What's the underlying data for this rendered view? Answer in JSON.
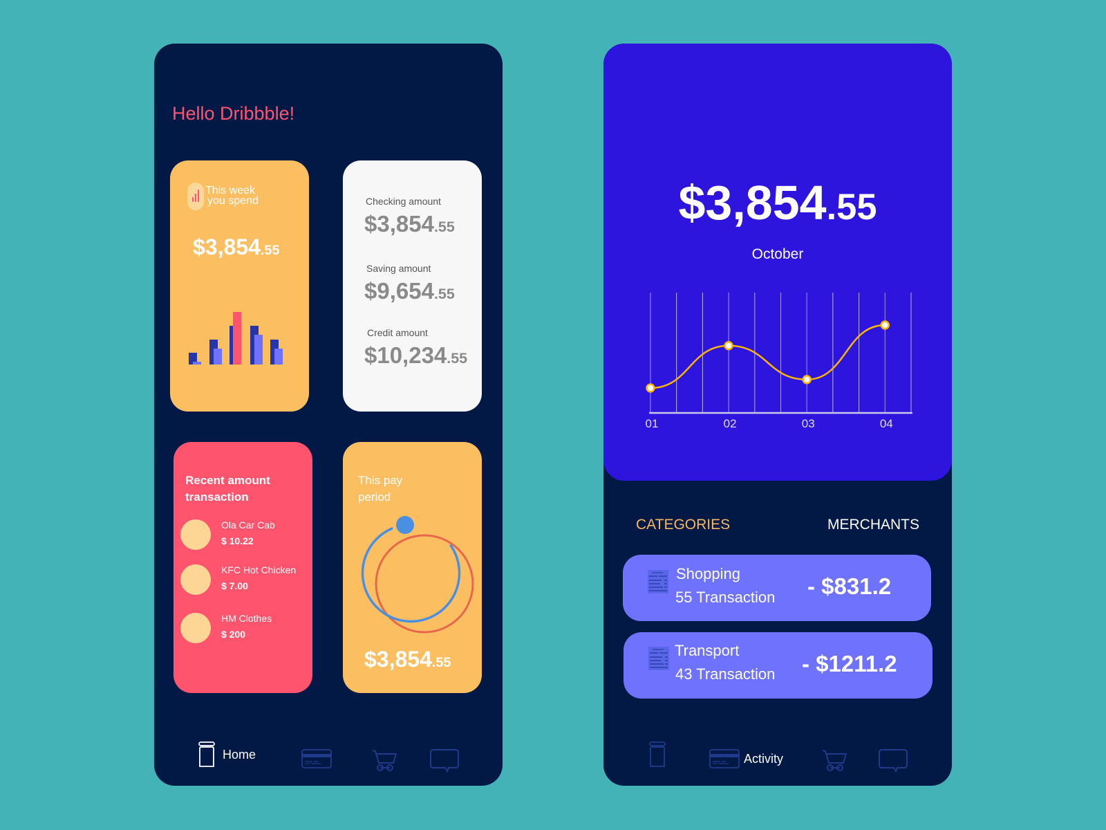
{
  "left_phone": {
    "greeting": "Hello Dribbble!",
    "spend_card": {
      "label_line1": "This week",
      "label_line2": "you spend",
      "amount_main": "$3,854",
      "amount_cents": ".55",
      "icon": "bar-chart-icon",
      "mini_chart": {
        "series": [
          {
            "name": "dark",
            "color": "#2636a8",
            "values": [
              0.22,
              0.48,
              0.74,
              0.74,
              0.48
            ]
          },
          {
            "name": "light",
            "color": "#6e72fc",
            "values": [
              0.05,
              0.3,
              1.0,
              0.56,
              0.3
            ]
          }
        ],
        "highlight_index": 2,
        "highlight_color": "#ff546d"
      }
    },
    "accounts_card": {
      "items": [
        {
          "label": "Checking amount",
          "amount_main": "$3,854",
          "amount_cents": ".55"
        },
        {
          "label": "Saving amount",
          "amount_main": "$9,654",
          "amount_cents": ".55"
        },
        {
          "label": "Credit amount",
          "amount_main": "$10,234",
          "amount_cents": ".55"
        }
      ]
    },
    "recent_card": {
      "title_line1": "Recent amount",
      "title_line2": "transaction",
      "transactions": [
        {
          "name": "Ola Car Cab",
          "amount": "$ 10.22"
        },
        {
          "name": "KFC Hot Chicken",
          "amount": "$ 7.00"
        },
        {
          "name": "HM Clothes",
          "amount": "$ 200"
        }
      ]
    },
    "pay_card": {
      "title_line1": "This pay",
      "title_line2": "period",
      "amount_main": "$3,854",
      "amount_cents": ".55",
      "ring_colors": {
        "progress": "#4a90e2",
        "track": "#e8674a"
      }
    },
    "nav": {
      "active": "home",
      "items": [
        {
          "id": "home",
          "icon": "jar-icon",
          "label": "Home"
        },
        {
          "id": "activity",
          "icon": "credit-card-icon",
          "label": ""
        },
        {
          "id": "cart",
          "icon": "cart-icon",
          "label": ""
        },
        {
          "id": "messages",
          "icon": "chat-icon",
          "label": ""
        }
      ]
    }
  },
  "right_phone": {
    "hero": {
      "amount_main": "$3,854",
      "amount_cents": ".55",
      "month": "October"
    },
    "chart_data": {
      "type": "line",
      "title": "",
      "xlabel": "",
      "ylabel": "",
      "categories": [
        "01",
        "02",
        "03",
        "04"
      ],
      "values": [
        20,
        55,
        27,
        72
      ],
      "ylim": [
        0,
        100
      ],
      "grid": "vertical",
      "line_color": "#fbb400",
      "point_fill": "#ffffff"
    },
    "tabs": [
      {
        "label": "CATEGORIES",
        "active": true
      },
      {
        "label": "MERCHANTS",
        "active": false
      }
    ],
    "categories": [
      {
        "name": "Shopping",
        "count": "55 Transaction",
        "amount": "- $831.2",
        "icon": "receipt-icon"
      },
      {
        "name": "Transport",
        "count": "43 Transaction",
        "amount": "- $1211.2",
        "icon": "receipt-icon"
      }
    ],
    "nav": {
      "active": "activity",
      "items": [
        {
          "id": "home",
          "icon": "jar-icon",
          "label": ""
        },
        {
          "id": "activity",
          "icon": "credit-card-icon",
          "label": "Activity"
        },
        {
          "id": "cart",
          "icon": "cart-icon",
          "label": ""
        },
        {
          "id": "messages",
          "icon": "chat-icon",
          "label": ""
        }
      ]
    }
  }
}
